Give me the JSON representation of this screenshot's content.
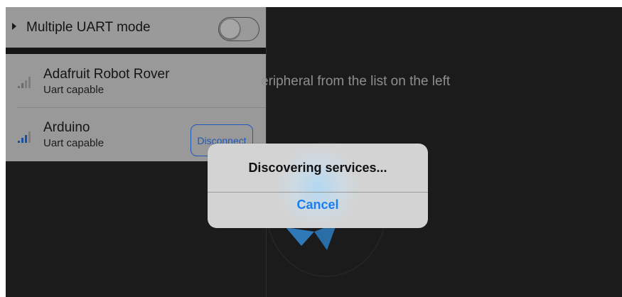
{
  "uart_mode": {
    "label": "Multiple UART mode",
    "enabled": false
  },
  "devices": [
    {
      "name": "Adafruit Robot Rover",
      "subtitle": "Uart capable",
      "signal_bars": 2,
      "connected": false
    },
    {
      "name": "Arduino",
      "subtitle": "Uart capable",
      "signal_bars": 3,
      "connected": true,
      "action_label": "Disconnect"
    }
  ],
  "main": {
    "instruction_text": "eripheral from the list on the left"
  },
  "alert": {
    "title": "Discovering services...",
    "cancel_label": "Cancel"
  },
  "colors": {
    "accent_blue": "#1a7ef0",
    "signal_blue": "#1a4fa8",
    "panel_gray": "#999999",
    "background_dark": "#1b1b1b"
  }
}
